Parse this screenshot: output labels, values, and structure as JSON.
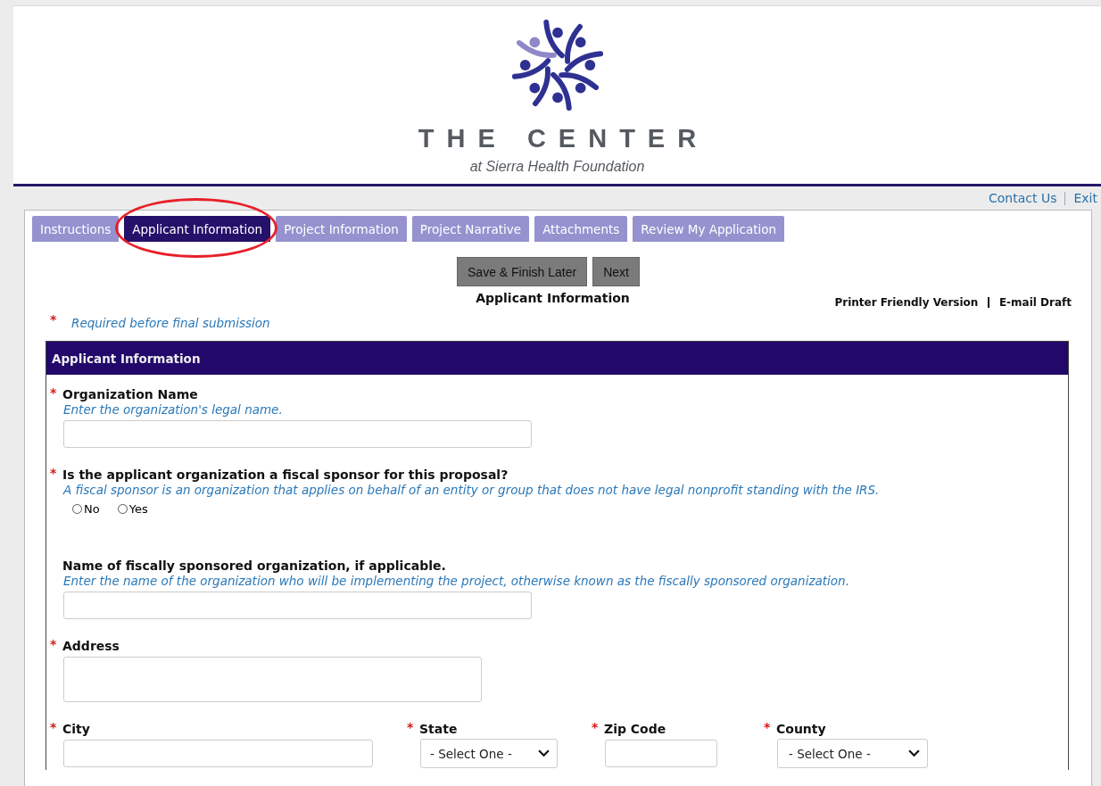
{
  "header": {
    "brand": "THE CENTER",
    "tagline": "at Sierra Health Foundation"
  },
  "top_links": [
    {
      "label": "Contact Us"
    },
    {
      "label": "Exit"
    }
  ],
  "tabs": [
    {
      "label": "Instructions",
      "selected": false,
      "circled": false
    },
    {
      "label": "Applicant Information",
      "selected": true,
      "circled": true
    },
    {
      "label": "Project Information",
      "selected": false,
      "circled": false
    },
    {
      "label": "Project Narrative",
      "selected": false,
      "circled": false
    },
    {
      "label": "Attachments",
      "selected": false,
      "circled": false
    },
    {
      "label": "Review My Application",
      "selected": false,
      "circled": false
    }
  ],
  "actions": [
    {
      "label": "Save & Finish Later"
    },
    {
      "label": "Next"
    }
  ],
  "page_title": "Applicant Information",
  "page_links": [
    {
      "label": "Printer Friendly Version"
    },
    {
      "label": "E-mail Draft"
    }
  ],
  "required_note": {
    "mark": "*",
    "text": "Required before final submission"
  },
  "section": {
    "title": "Applicant Information",
    "fields": [
      {
        "kind": "text",
        "mark": "*",
        "label": "Organization Name",
        "hint": "Enter the organization's legal name."
      },
      {
        "kind": "radio",
        "mark": "*",
        "label": "Is the applicant organization a fiscal sponsor for this proposal?",
        "hint": "A fiscal sponsor is an organization that applies on behalf of an entity or group that does not have legal nonprofit standing with the IRS.",
        "options": [
          {
            "label": "No",
            "selected": false
          },
          {
            "label": "Yes",
            "selected": false
          }
        ]
      },
      {
        "kind": "text",
        "label": "Name of fiscally sponsored organization, if applicable.",
        "hint": "Enter the name of the organization who will be implementing the project, otherwise known as the fiscally sponsored organization."
      },
      {
        "kind": "textarea",
        "mark": "*",
        "label": "Address"
      },
      {
        "kind": "row",
        "items": [
          {
            "kind": "text",
            "mark": "*",
            "label": "City"
          },
          {
            "kind": "select",
            "mark": "*",
            "label": "State",
            "value": "- Select One -"
          },
          {
            "kind": "text",
            "mark": "*",
            "label": "Zip Code"
          },
          {
            "kind": "select",
            "mark": "*",
            "label": "County",
            "value": "- Select One -"
          }
        ]
      }
    ]
  }
}
